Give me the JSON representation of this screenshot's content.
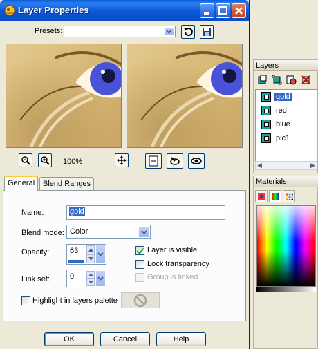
{
  "dialog": {
    "title": "Layer Properties",
    "presets_label": "Presets:",
    "presets_value": "",
    "zoom_level": "100%"
  },
  "tabs": [
    {
      "label": "General",
      "active": true
    },
    {
      "label": "Blend Ranges",
      "active": false
    }
  ],
  "general": {
    "name_label": "Name:",
    "name_value": "gold",
    "blend_mode_label": "Blend mode:",
    "blend_mode_value": "Color",
    "opacity_label": "Opacity:",
    "opacity_value": "63",
    "opacity_fraction": 0.63,
    "link_set_label": "Link set:",
    "link_set_value": "0",
    "layer_visible_label": "Layer is visible",
    "layer_visible_checked": true,
    "lock_transparency_label": "Lock transparency",
    "lock_transparency_checked": false,
    "group_linked_label": "Group is linked",
    "group_linked_enabled": false,
    "highlight_label": "Highlight in layers palette",
    "highlight_checked": false
  },
  "buttons": {
    "ok": "OK",
    "cancel": "Cancel",
    "help": "Help"
  },
  "layers_panel": {
    "title": "Layers",
    "layers": [
      {
        "name": "gold",
        "selected": true
      },
      {
        "name": "red",
        "selected": false
      },
      {
        "name": "blue",
        "selected": false
      },
      {
        "name": "pic1",
        "selected": false
      }
    ]
  },
  "materials_panel": {
    "title": "Materials"
  },
  "colors": {
    "title_bar": "#0b58d6",
    "selection": "#316ac5",
    "dialog_bg": "#ece9d8",
    "layer_thumb": "#16a39a"
  }
}
